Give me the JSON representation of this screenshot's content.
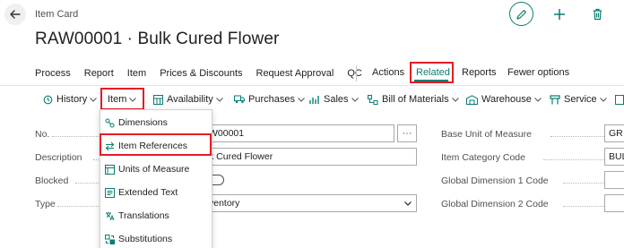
{
  "header": {
    "caption": "Item Card",
    "title": "RAW00001 · Bulk Cured Flower"
  },
  "action_bar": {
    "items": [
      "Process",
      "Report",
      "Item",
      "Prices & Discounts",
      "Request Approval",
      "QC"
    ],
    "actions_label": "Actions",
    "related_label": "Related",
    "reports_label": "Reports",
    "fewer_options_label": "Fewer options"
  },
  "toolbar": {
    "history": "History",
    "item": "Item",
    "availability": "Availability",
    "purchases": "Purchases",
    "sales": "Sales",
    "bom": "Bill of Materials",
    "warehouse": "Warehouse",
    "service": "Service"
  },
  "dropdown": {
    "items": [
      "Dimensions",
      "Item References",
      "Units of Measure",
      "Extended Text",
      "Translations",
      "Substitutions"
    ]
  },
  "form": {
    "left": [
      {
        "label": "No.",
        "value": "W00001"
      },
      {
        "label": "Description",
        "value": "k Cured Flower"
      },
      {
        "label": "Blocked",
        "value": ""
      },
      {
        "label": "Type",
        "value": "ventory"
      }
    ],
    "right": [
      {
        "label": "Base Unit of Measure",
        "value": "GR"
      },
      {
        "label": "Item Category Code",
        "value": "BULI"
      },
      {
        "label": "Global Dimension 1 Code",
        "value": ""
      },
      {
        "label": "Global Dimension 2 Code",
        "value": ""
      }
    ],
    "assist_label": "···"
  },
  "colors": {
    "accent": "#0a7d70",
    "highlight": "#e51c24"
  }
}
